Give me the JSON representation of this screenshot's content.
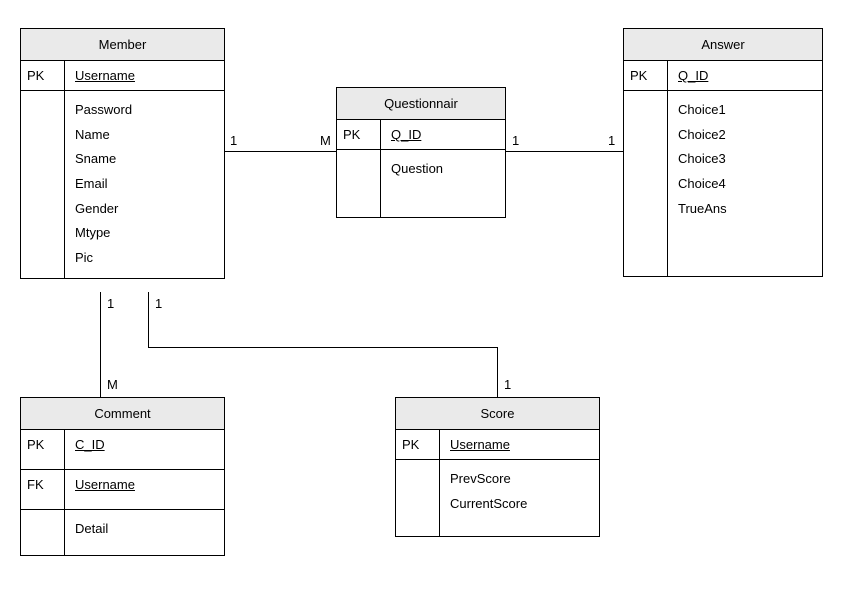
{
  "entities": {
    "member": {
      "title": "Member",
      "pk_label": "PK",
      "pk_attr": "Username",
      "attrs": [
        "Password",
        "Name",
        "Sname",
        "Email",
        "Gender",
        "Mtype",
        "Pic"
      ]
    },
    "questionnair": {
      "title": "Questionnair",
      "pk_label": "PK",
      "pk_attr": "Q_ID",
      "attrs": [
        "Question"
      ]
    },
    "answer": {
      "title": "Answer",
      "pk_label": "PK",
      "pk_attr": "Q_ID",
      "attrs": [
        "Choice1",
        "Choice2",
        "Choice3",
        "Choice4",
        "TrueAns"
      ]
    },
    "comment": {
      "title": "Comment",
      "pk_label": "PK",
      "pk_attr": "C_ID",
      "fk_label": "FK",
      "fk_attr": "Username",
      "attrs": [
        "Detail"
      ]
    },
    "score": {
      "title": "Score",
      "pk_label": "PK",
      "pk_attr": "Username",
      "attrs": [
        "PrevScore",
        "CurrentScore"
      ]
    }
  },
  "cardinality": {
    "member_quest_1": "1",
    "member_quest_m": "M",
    "quest_answer_1l": "1",
    "quest_answer_1r": "1",
    "member_comment_1": "1",
    "member_comment_m": "M",
    "member_score_1": "1",
    "member_score_1b": "1"
  }
}
